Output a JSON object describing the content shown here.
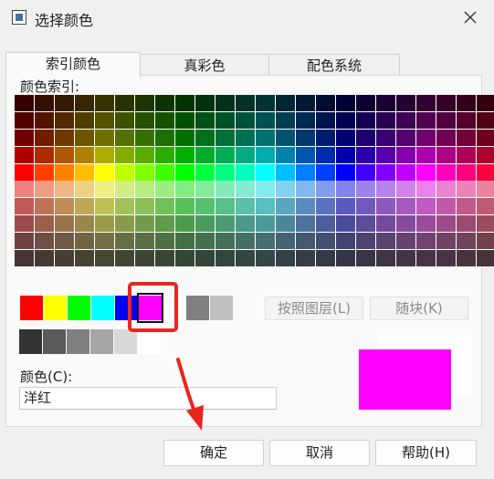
{
  "window": {
    "title": "选择颜色",
    "icon": "color-picker-app-icon",
    "close_icon": "close-icon"
  },
  "tabs": [
    {
      "label": "索引颜色",
      "active": true
    },
    {
      "label": "真彩色",
      "active": false
    },
    {
      "label": "配色系统",
      "active": false
    }
  ],
  "index_panel": {
    "label": "颜色索引:"
  },
  "standard_colors": [
    "#ff0000",
    "#ffff00",
    "#00ff00",
    "#00ffff",
    "#0000ff",
    "#ff00ff",
    "#ffffff"
  ],
  "gray_colors_row1": [
    "#808080",
    "#c0c0c0"
  ],
  "gray_colors_row2": [
    "#333333",
    "#5a5a5a",
    "#808080",
    "#a6a6a6",
    "#d9d9d9",
    "#ffffff"
  ],
  "selected_color": "#ff00ff",
  "buttons": {
    "by_layer": "按照图层(L)",
    "by_block": "随块(K)",
    "ok": "确定",
    "cancel": "取消",
    "help": "帮助(H)"
  },
  "color_field": {
    "label": "颜色(C):",
    "value": "洋红"
  },
  "preview": {
    "new_color": "#ff00ff",
    "old_color": "#ffffff"
  },
  "annotations": {
    "highlight_color": "#e8261f"
  }
}
